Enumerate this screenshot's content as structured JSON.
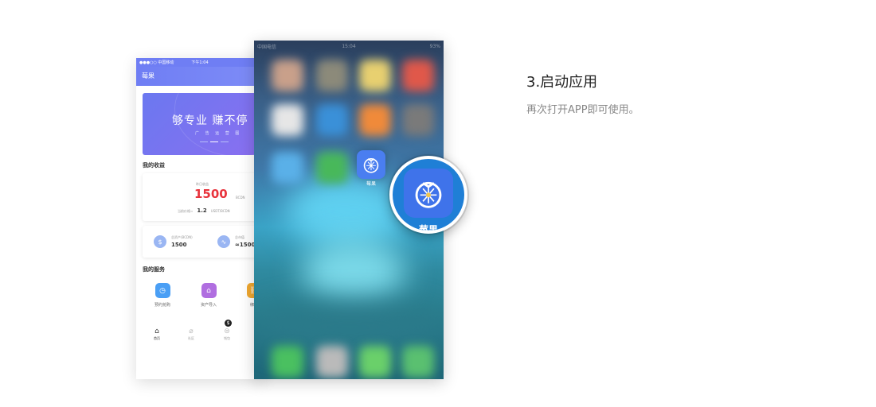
{
  "app_phone": {
    "status": {
      "carrier": "●●●○○ 中国移动 ",
      "time": "下午1:04"
    },
    "header_title": "莓果",
    "banner": {
      "title": "够专业  赚不停",
      "subtitle": "广 告 运 营 图"
    },
    "earnings_section": "我的收益",
    "earnings": {
      "label": "昨日收益",
      "value": "1500",
      "unit": "BCDN",
      "price_label": "当前价格≈",
      "price_value": "1.2",
      "price_unit": "USDT/BCDN"
    },
    "total_asset": {
      "label": "总资产(BCDN)",
      "value": "1500"
    },
    "market_value": {
      "label": "总市值",
      "value": "≈1500"
    },
    "services_section": "我的服务",
    "services": [
      {
        "label": "预约抢购",
        "color": "#4a9ff5",
        "icon": "clock-icon"
      },
      {
        "label": "资产导入",
        "color": "#b06ee0",
        "icon": "home-icon"
      },
      {
        "label": "绑定",
        "color": "#f0a830",
        "icon": "link-icon"
      }
    ],
    "tabbar": [
      {
        "label": "首页",
        "icon": "home-icon"
      },
      {
        "label": "社区",
        "icon": "leaf-icon"
      },
      {
        "label": "钱包",
        "icon": "coin-icon"
      }
    ],
    "wallet_badge": "$"
  },
  "home_phone": {
    "status": {
      "carrier": "中国电信 ",
      "time": "15:04",
      "battery": "93%"
    },
    "app_name": "莓果"
  },
  "step": {
    "title": "3.启动应用",
    "description": "再次打开APP即可使用。"
  },
  "colors": {
    "brand": "#6f7ef4",
    "app_icon": "#3f73ea",
    "earn_red": "#e8333c"
  }
}
